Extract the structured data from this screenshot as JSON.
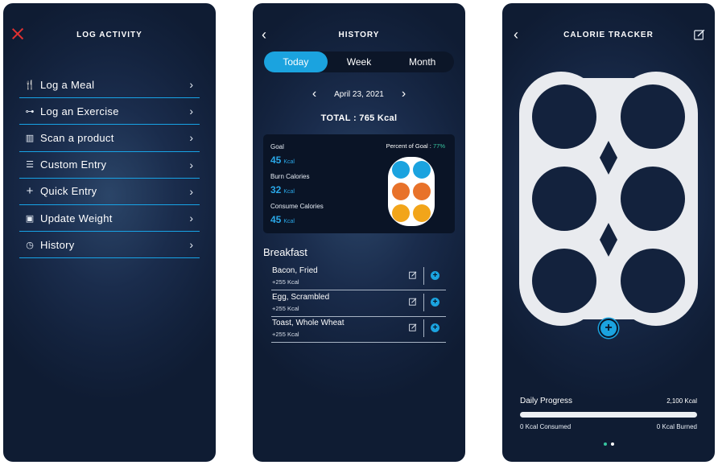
{
  "colors": {
    "accent": "#1ba3df",
    "close_red": "#e03131",
    "goal_green": "#38c6a0",
    "bg": "#13223d"
  },
  "log_activity": {
    "title": "LOG ACTIVITY",
    "close_icon": "close-icon",
    "items": [
      {
        "label": "Log a Meal",
        "icon": "fork-knife-icon"
      },
      {
        "label": "Log an Exercise",
        "icon": "dumbbell-icon"
      },
      {
        "label": "Scan a product",
        "icon": "barcode-icon"
      },
      {
        "label": "Custom Entry",
        "icon": "sliders-icon"
      },
      {
        "label": "Quick Entry",
        "icon": "plus-icon"
      },
      {
        "label": "Update Weight",
        "icon": "scale-icon"
      },
      {
        "label": "History",
        "icon": "history-icon"
      }
    ]
  },
  "history": {
    "title": "HISTORY",
    "tabs": [
      "Today",
      "Week",
      "Month"
    ],
    "active_tab": "Today",
    "date": "April 23, 2021",
    "total": "TOTAL : 765 Kcal",
    "summary": {
      "goal_label": "Goal",
      "goal_value": "45",
      "goal_unit": "Kcal",
      "burn_label": "Burn Calories",
      "burn_value": "32",
      "burn_unit": "Kcal",
      "consume_label": "Consume Calories",
      "consume_value": "45",
      "consume_unit": "Kcal",
      "percent_label": "Percent of Goal :",
      "percent_value": "77%",
      "dot_colors": [
        "#1ba3df",
        "#1ba3df",
        "#e8722a",
        "#e8722a",
        "#f2a51a",
        "#f2a51a"
      ]
    },
    "section": "Breakfast",
    "foods": [
      {
        "name": "Bacon, Fried",
        "kcal": "+255 Kcal"
      },
      {
        "name": "Egg, Scrambled",
        "kcal": "+255 Kcal"
      },
      {
        "name": "Toast, Whole Wheat",
        "kcal": "+255 Kcal"
      }
    ],
    "add_glyph": "+"
  },
  "tracker": {
    "title": "CALORIE TRACKER",
    "add_glyph": "+",
    "progress_label": "Daily Progress",
    "goal": "2,100 Kcal",
    "consumed": "0 Kcal Consumed",
    "burned": "0 Kcal Burned",
    "progress_fraction": 0,
    "pages": 2,
    "active_page": 0
  }
}
